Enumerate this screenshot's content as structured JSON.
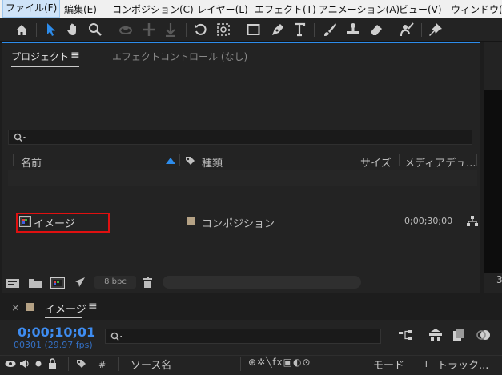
{
  "menu": [
    {
      "label": "ファイル(F)",
      "selected": true
    },
    {
      "label": "編集(E)"
    },
    {
      "label": "コンポジション(C)"
    },
    {
      "label": "レイヤー(L)"
    },
    {
      "label": "エフェクト(T)"
    },
    {
      "label": "アニメーション(A)"
    },
    {
      "label": "ビュー(V)"
    },
    {
      "label": "ウィンドウ(W"
    }
  ],
  "toolbar": {
    "icons": [
      "home-icon",
      "selection-tool-icon",
      "hand-tool-icon",
      "zoom-tool-icon",
      "orbit-camera-icon",
      "pan-camera-icon",
      "dolly-camera-icon",
      "rotate-tool-icon",
      "pan-behind-tool-icon",
      "rectangle-tool-icon",
      "pen-tool-icon",
      "type-tool-icon",
      "brush-tool-icon",
      "clone-stamp-icon",
      "eraser-icon",
      "roto-brush-icon",
      "puppet-pin-icon"
    ]
  },
  "project_panel": {
    "tabs": [
      {
        "label": "プロジェクト",
        "menu": "≡",
        "active": true
      },
      {
        "label": "エフェクトコントロール (なし)",
        "active": false
      }
    ],
    "search_placeholder": "",
    "columns": {
      "name": "名前",
      "type": "種類",
      "size": "サイズ",
      "duration": "メディアデュ..."
    },
    "rows": [
      {
        "name": "イメージ",
        "type": "コンポジション",
        "duration": "0;00;30;00",
        "label_color": "#b5a285"
      }
    ],
    "bottom": {
      "bpc": "8 bpc"
    }
  },
  "right_strip": {
    "partial": "3"
  },
  "timeline": {
    "tab_label": "イメージ",
    "tab_menu": "≡",
    "timecode": "0;00;10;01",
    "frames_fps": "00301 (29.97 fps)",
    "headers": {
      "source_name": "ソース名",
      "hash": "#",
      "mode": "モード",
      "t": "T",
      "track": "トラック..."
    }
  },
  "colors": {
    "accent": "#2d8ceb",
    "timecode": "#3e8cf0",
    "highlight_box": "#e01010"
  }
}
